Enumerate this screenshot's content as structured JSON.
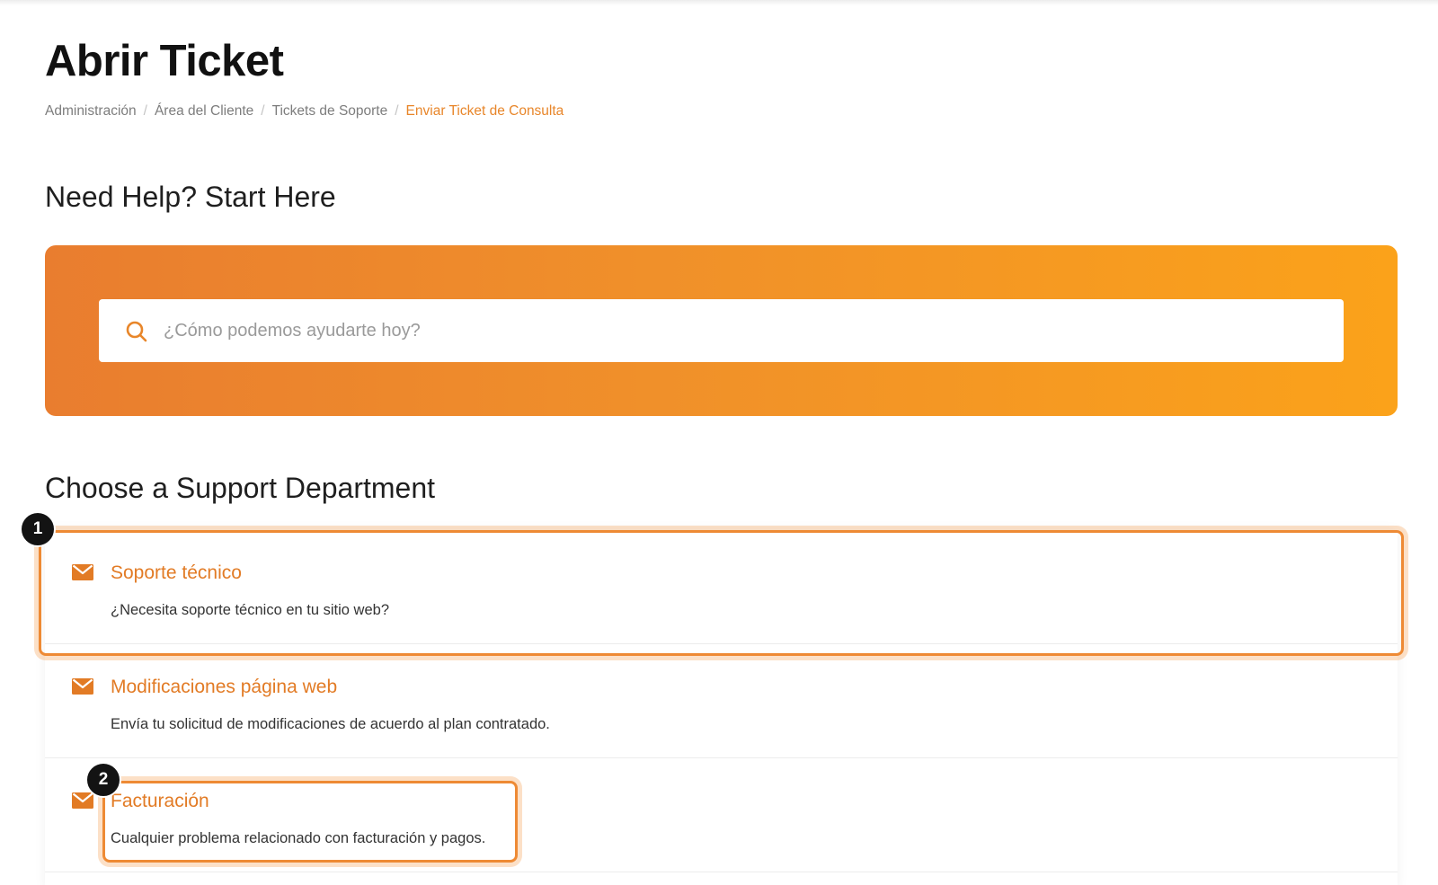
{
  "page": {
    "title": "Abrir Ticket"
  },
  "breadcrumb": [
    {
      "label": "Administración",
      "active": false
    },
    {
      "label": "Área del Cliente",
      "active": false
    },
    {
      "label": "Tickets de Soporte",
      "active": false
    },
    {
      "label": "Enviar Ticket de Consulta",
      "active": true
    }
  ],
  "breadcrumb_separator": "/",
  "help": {
    "heading": "Need Help? Start Here",
    "search_placeholder": "¿Cómo podemos ayudarte hoy?",
    "search_icon": "search-icon"
  },
  "departments": {
    "heading": "Choose a Support Department",
    "icon": "envelope-icon",
    "items": [
      {
        "name": "Soporte técnico",
        "description": "¿Necesita soporte técnico en tu sitio web?"
      },
      {
        "name": "Modificaciones página web",
        "description": "Envía tu solicitud de modificaciones de acuerdo al plan contratado."
      },
      {
        "name": "Facturación",
        "description": "Cualquier problema relacionado con facturación y pagos."
      }
    ]
  },
  "annotations": {
    "badges": [
      "1",
      "2"
    ]
  },
  "colors": {
    "accent": "#e8862a",
    "banner_start": "#e97d2f",
    "banner_end": "#fba21a",
    "highlight": "#ee8a34",
    "badge": "#131313"
  }
}
